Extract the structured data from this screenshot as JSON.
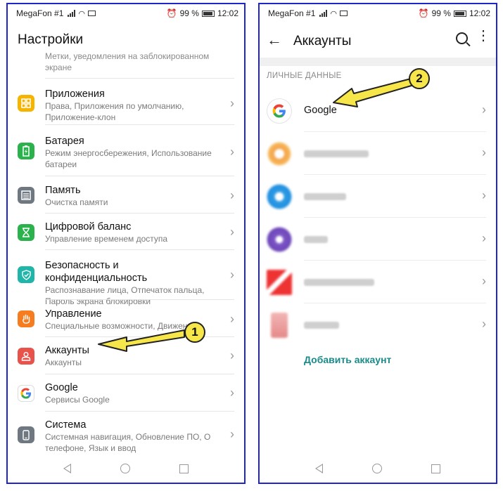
{
  "left": {
    "status": {
      "carrier": "MegaFon #1",
      "battery": "99 %",
      "time": "12:02"
    },
    "title": "Настройки",
    "items": [
      {
        "title": "",
        "sub": "Метки, уведомления на заблокированном экране"
      },
      {
        "title": "Приложения",
        "sub": "Права, Приложения по умолчанию, Приложение-клон",
        "icon": "apps-icon",
        "color": "#f5b400"
      },
      {
        "title": "Батарея",
        "sub": "Режим энергосбережения, Использование батареи",
        "icon": "battery-icon",
        "color": "#2bb24c"
      },
      {
        "title": "Память",
        "sub": "Очистка памяти",
        "icon": "memory-icon",
        "color": "#6f7880"
      },
      {
        "title": "Цифровой баланс",
        "sub": "Управление временем доступа",
        "icon": "hourglass-icon",
        "color": "#2bb24c"
      },
      {
        "title": "Безопасность и конфиденциальность",
        "sub": "Распознавание лица, Отпечаток пальца, Пароль экрана блокировки",
        "icon": "shield-icon",
        "color": "#1fb5a8"
      },
      {
        "title": "Управление",
        "sub": "Специальные возможности, Движения",
        "icon": "hand-icon",
        "color": "#f57d1f"
      },
      {
        "title": "Аккаунты",
        "sub": "Аккаунты",
        "icon": "account-icon",
        "color": "#e9524a"
      },
      {
        "title": "Google",
        "sub": "Сервисы Google",
        "icon": "google-icon",
        "color": "#ffffff"
      },
      {
        "title": "Система",
        "sub": "Системная навигация, Обновление ПО, О телефоне, Язык и ввод",
        "icon": "system-icon",
        "color": "#6f7880"
      }
    ]
  },
  "right": {
    "status": {
      "carrier": "MegaFon #1",
      "battery": "99 %",
      "time": "12:02"
    },
    "title": "Аккаунты",
    "section": "ЛИЧНЫЕ ДАННЫЕ",
    "accounts": [
      {
        "name": "Google",
        "icon": "google-icon"
      },
      {
        "name": "",
        "icon": "blurred-app-icon"
      },
      {
        "name": "",
        "icon": "blurred-app-icon"
      },
      {
        "name": "",
        "icon": "blurred-app-icon"
      },
      {
        "name": "",
        "icon": "blurred-app-icon"
      },
      {
        "name": "",
        "icon": "blurred-app-icon"
      }
    ],
    "add_account": "Добавить аккаунт"
  },
  "annotations": {
    "badge1": "1",
    "badge2": "2"
  }
}
